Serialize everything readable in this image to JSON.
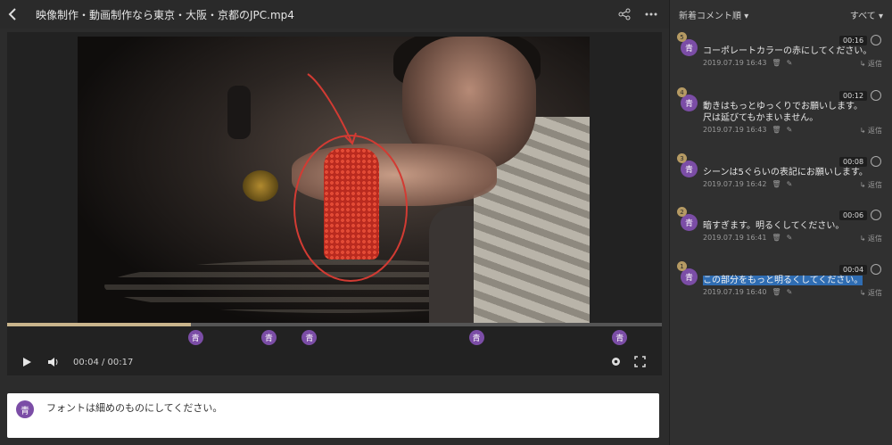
{
  "header": {
    "title": "映像制作・動画制作なら東京・大阪・京都のJPC.mp4"
  },
  "player": {
    "progress_percent": 28,
    "time": "00:04 / 00:17",
    "markers": [
      {
        "label": "青",
        "position_percent": 28.7
      },
      {
        "label": "青",
        "position_percent": 39.9
      },
      {
        "label": "青",
        "position_percent": 46.1
      },
      {
        "label": "青",
        "position_percent": 71.6
      },
      {
        "label": "青",
        "position_percent": 93.5
      }
    ]
  },
  "comment_box": {
    "avatar": "青",
    "text": "フォントは細めのものにしてください。"
  },
  "panel": {
    "sort_label": "新着コメント順",
    "filter_label": "すべて",
    "comments": [
      {
        "number": "5",
        "avatar": "青",
        "time": "00:16",
        "lines": [
          "コーポレートカラーの赤にしてください。"
        ],
        "date": "2019.07.19 16:43",
        "reply": "返信"
      },
      {
        "number": "4",
        "avatar": "青",
        "time": "00:12",
        "lines": [
          "動きはもっとゆっくりでお願いします。",
          "尺は延びてもかまいません。"
        ],
        "date": "2019.07.19 16:43",
        "reply": "返信"
      },
      {
        "number": "3",
        "avatar": "青",
        "time": "00:08",
        "lines": [
          "シーンは5ぐらいの表記にお願いします。"
        ],
        "date": "2019.07.19 16:42",
        "reply": "返信"
      },
      {
        "number": "2",
        "avatar": "青",
        "time": "00:06",
        "lines": [
          "暗すぎます。明るくしてください。"
        ],
        "date": "2019.07.19 16:41",
        "reply": "返信"
      },
      {
        "number": "1",
        "avatar": "青",
        "time": "00:04",
        "lines": [
          "この部分をもっと明るくしてください。"
        ],
        "date": "2019.07.19 16:40",
        "reply": "返信"
      }
    ]
  }
}
